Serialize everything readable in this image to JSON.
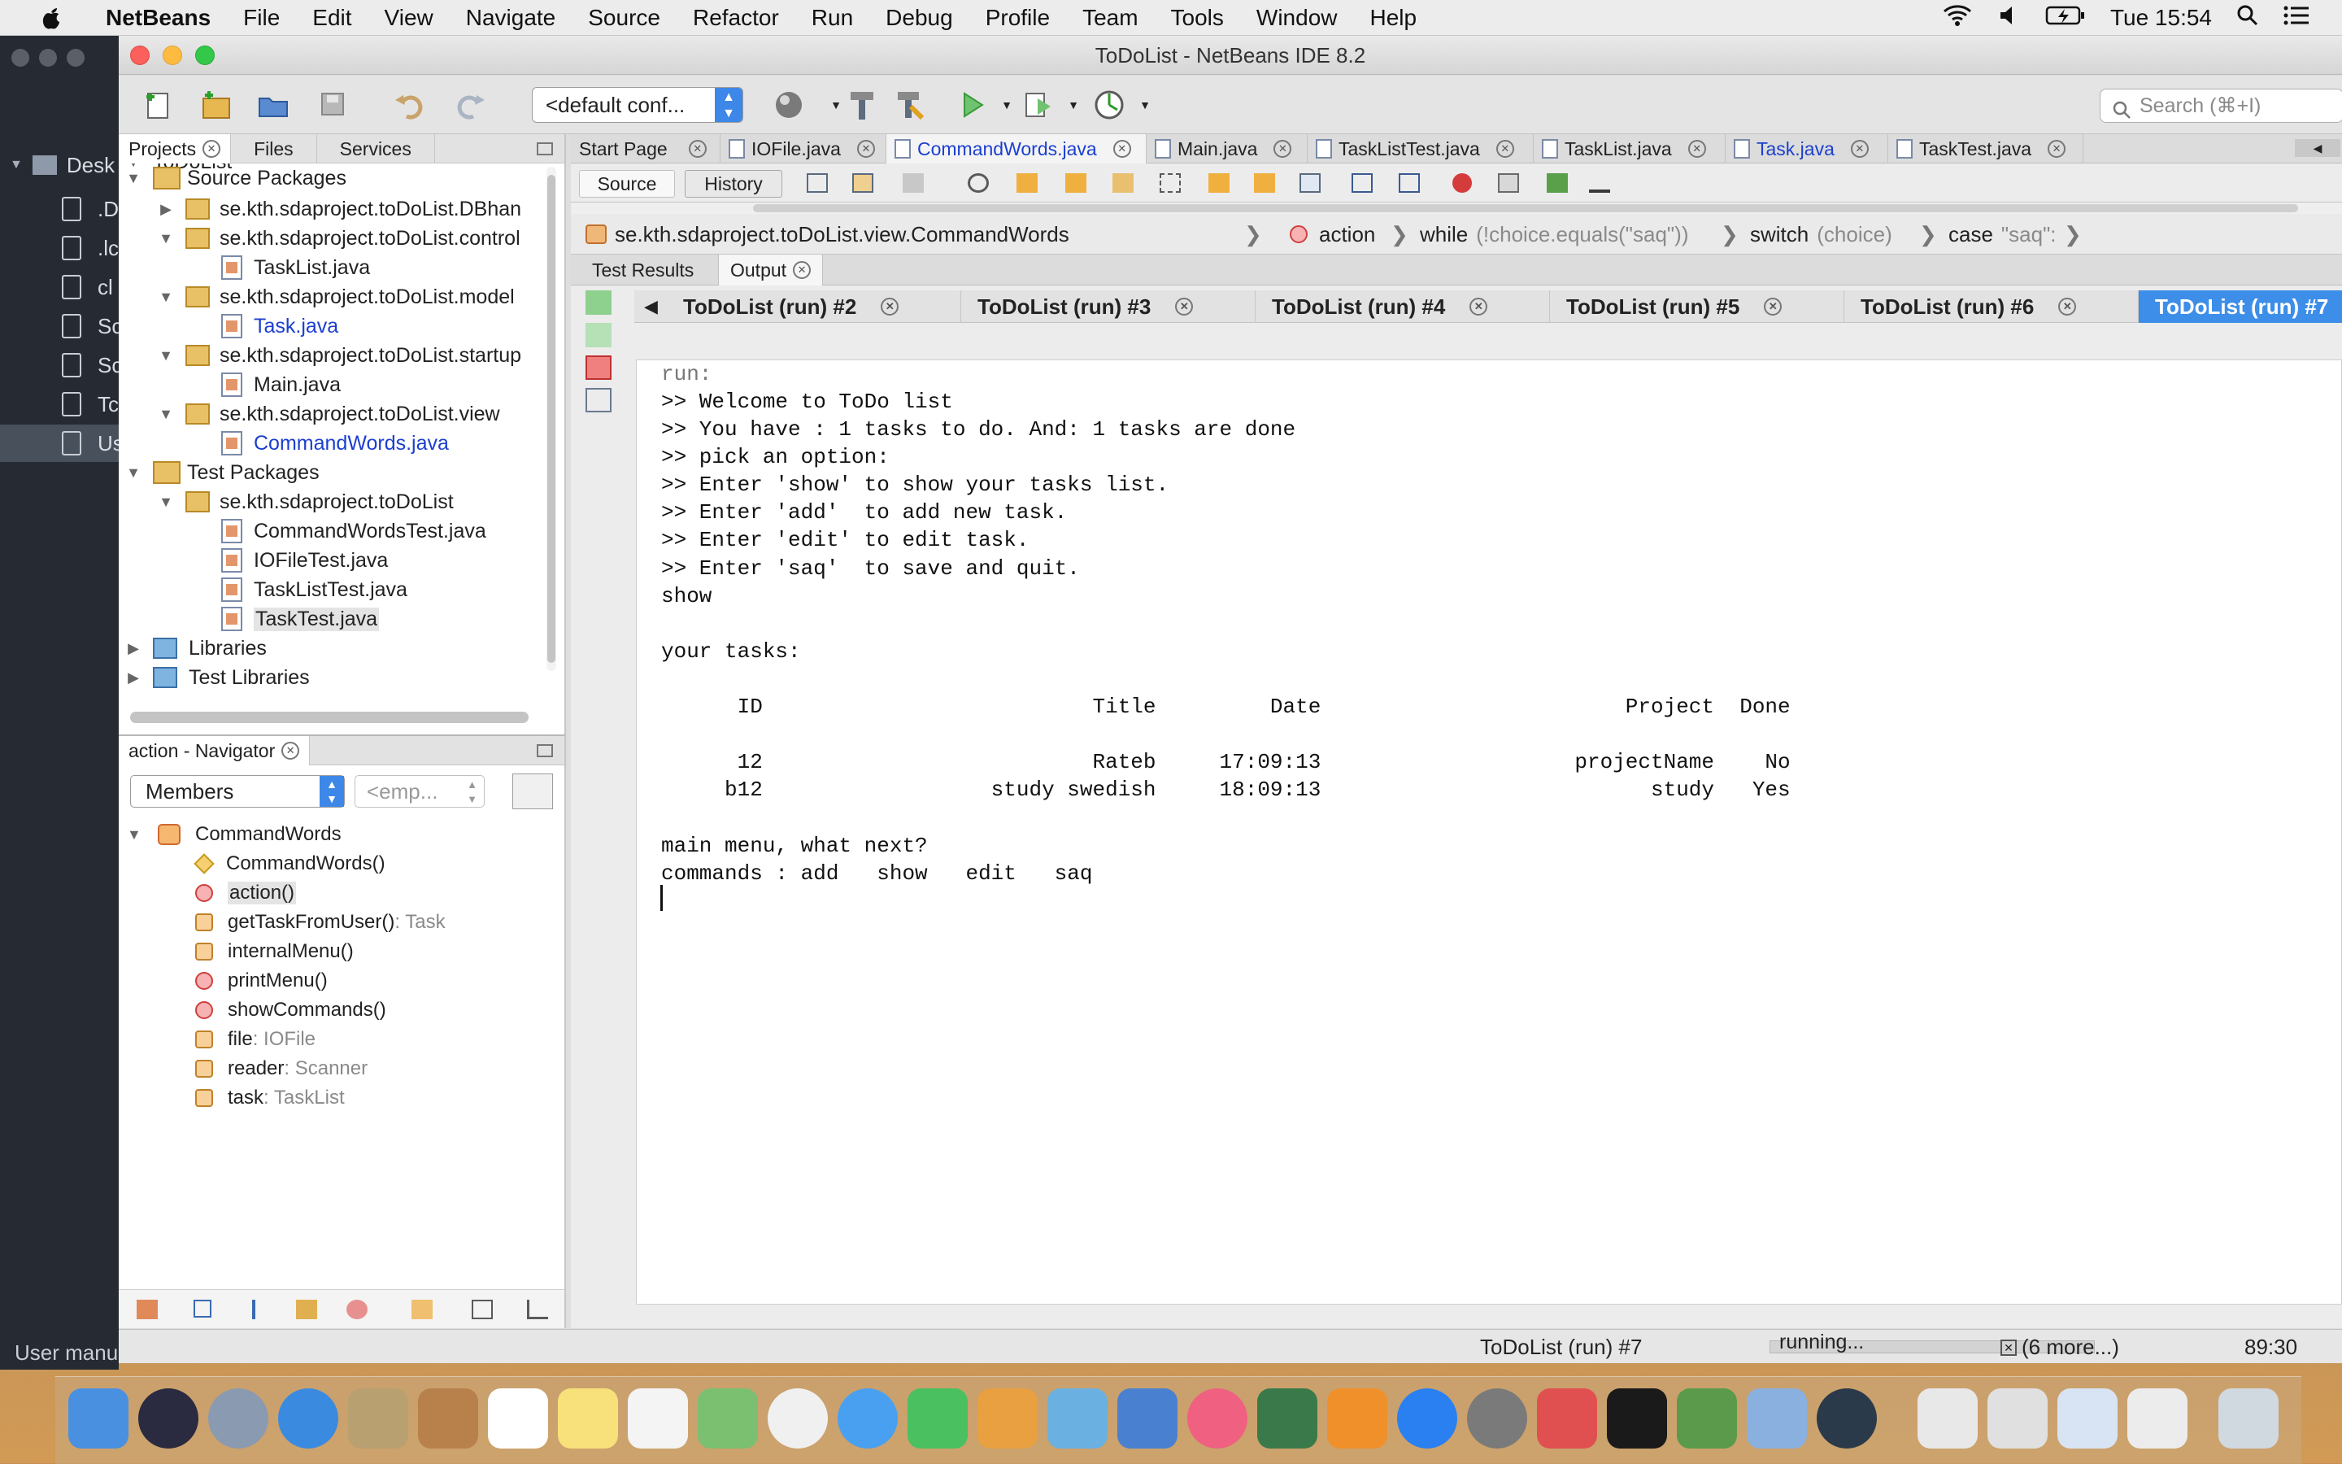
{
  "menubar": {
    "app": "NetBeans",
    "items": [
      "File",
      "Edit",
      "View",
      "Navigate",
      "Source",
      "Refactor",
      "Run",
      "Debug",
      "Profile",
      "Team",
      "Tools",
      "Window",
      "Help"
    ],
    "clock": "Tue 15:54"
  },
  "finder": {
    "items": [
      "Desk",
      ".D",
      ".lc",
      "cl",
      "Sc",
      "Sc",
      "Tc",
      "Us"
    ],
    "bottom_label": "User manu"
  },
  "window": {
    "title": "ToDoList - NetBeans IDE 8.2",
    "config_value": "<default conf...",
    "search_placeholder": "Search (⌘+I)"
  },
  "projects": {
    "tabs": [
      "Projects",
      "Files",
      "Services"
    ],
    "tree": [
      {
        "label": "ToDoList"
      },
      {
        "label": "Source Packages"
      },
      {
        "label": "se.kth.sdaproject.toDoList.DBhan"
      },
      {
        "label": "se.kth.sdaproject.toDoList.control"
      },
      {
        "label": "TaskList.java"
      },
      {
        "label": "se.kth.sdaproject.toDoList.model"
      },
      {
        "label": "Task.java"
      },
      {
        "label": "se.kth.sdaproject.toDoList.startup"
      },
      {
        "label": "Main.java"
      },
      {
        "label": "se.kth.sdaproject.toDoList.view"
      },
      {
        "label": "CommandWords.java"
      },
      {
        "label": "Test Packages"
      },
      {
        "label": "se.kth.sdaproject.toDoList"
      },
      {
        "label": "CommandWordsTest.java"
      },
      {
        "label": "IOFileTest.java"
      },
      {
        "label": "TaskListTest.java"
      },
      {
        "label": "TaskTest.java"
      },
      {
        "label": "Libraries"
      },
      {
        "label": "Test Libraries"
      }
    ]
  },
  "navigator": {
    "title": "action - Navigator",
    "combo": "Members",
    "filter": "<emp...",
    "members": [
      {
        "name": "CommandWords",
        "type": ""
      },
      {
        "name": "CommandWords()",
        "type": ""
      },
      {
        "name": "action()",
        "type": ""
      },
      {
        "name": "getTaskFromUser()",
        "type": " : Task"
      },
      {
        "name": "internalMenu()",
        "type": ""
      },
      {
        "name": "printMenu()",
        "type": ""
      },
      {
        "name": "showCommands()",
        "type": ""
      },
      {
        "name": "file",
        "type": " : IOFile"
      },
      {
        "name": "reader",
        "type": " : Scanner"
      },
      {
        "name": "task",
        "type": " : TaskList"
      }
    ]
  },
  "editor": {
    "tabs": [
      "Start Page",
      "IOFile.java",
      "CommandWords.java",
      "Main.java",
      "TaskListTest.java",
      "TaskList.java",
      "Task.java",
      "TaskTest.java"
    ],
    "source_btn": "Source",
    "history_btn": "History",
    "breadcrumbs": {
      "cls": "se.kth.sdaproject.toDoList.view.CommandWords",
      "method": "action",
      "while_kw": "while",
      "while_cond": "(!choice.equals(\"saq\"))",
      "switch_kw": "switch",
      "switch_cond": "(choice)",
      "case_kw": "case",
      "case_val": "\"saq\":"
    }
  },
  "output": {
    "tabs": [
      "Test Results",
      "Output"
    ],
    "run_tabs": [
      "ToDoList (run) #2",
      "ToDoList (run) #3",
      "ToDoList (run) #4",
      "ToDoList (run) #5",
      "ToDoList (run) #6",
      "ToDoList (run) #7"
    ],
    "run_label": "run:",
    "console_text": ">> Welcome to ToDo list\n>> You have : 1 tasks to do. And: 1 tasks are done\n>> pick an option:\n>> Enter 'show' to show your tasks list.\n>> Enter 'add'  to add new task.\n>> Enter 'edit' to edit task.\n>> Enter 'saq'  to save and quit.\nshow\n\nyour tasks:\n\n      ID                          Title         Date                        Project  Done\n\n      12                          Rateb     17:09:13                    projectName    No\n     b12                  study swedish     18:09:13                          study   Yes\n\nmain menu, what next?\ncommands : add   show   edit   saq"
  },
  "statusbar": {
    "process": "ToDoList (run) #7",
    "state": "running...",
    "more": "(6 more...)",
    "position": "89:30"
  }
}
